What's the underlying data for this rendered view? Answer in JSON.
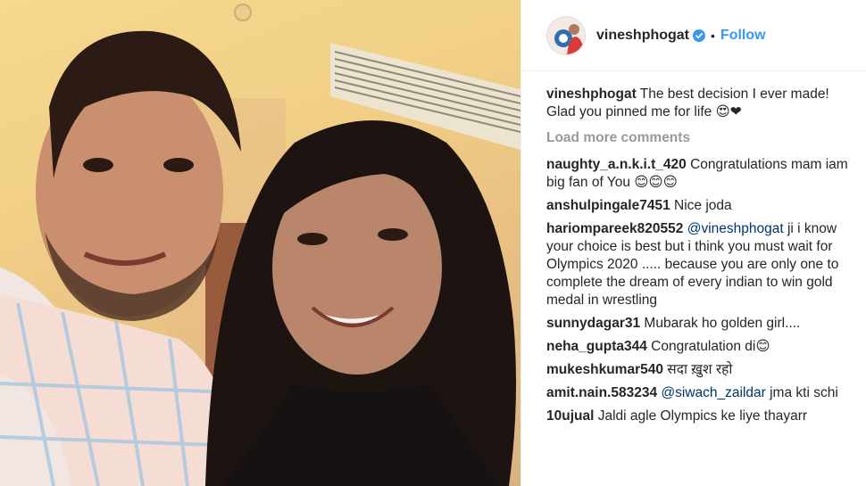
{
  "header": {
    "username": "vineshphogat",
    "separator": "•",
    "follow_label": "Follow"
  },
  "caption": {
    "user": "vineshphogat",
    "text": "The best decision I ever made! Glad you pinned me for life 😍❤"
  },
  "load_more_label": "Load more comments",
  "comments": [
    {
      "user": "naughty_a.n.k.i.t_420",
      "text": "Congratulations mam iam big fan of You 😊😊😊"
    },
    {
      "user": "anshulpingale7451",
      "text": "Nice joda"
    },
    {
      "user": "hariompareek820552",
      "mention": "@vineshphogat",
      "text": "ji i know your choice is best but i think you must wait for Olympics 2020 ..... because you are only one to complete the dream of every indian to win gold medal in wrestling"
    },
    {
      "user": "sunnydagar31",
      "text": "Mubarak ho golden girl...."
    },
    {
      "user": "neha_gupta344",
      "text": "Congratulation di😊"
    },
    {
      "user": "mukeshkumar540",
      "text": "सदा ख़ुश रहो"
    },
    {
      "user": "amit.nain.583234",
      "mention": "@siwach_zaildar",
      "text": "jma kti schi"
    },
    {
      "user": "10ujual",
      "text": "Jaldi agle Olympics ke liye thayarr"
    }
  ],
  "colors": {
    "link": "#3897f0",
    "mention": "#003569",
    "muted": "#999999"
  },
  "icons": {
    "verified": "verified-badge-icon"
  }
}
